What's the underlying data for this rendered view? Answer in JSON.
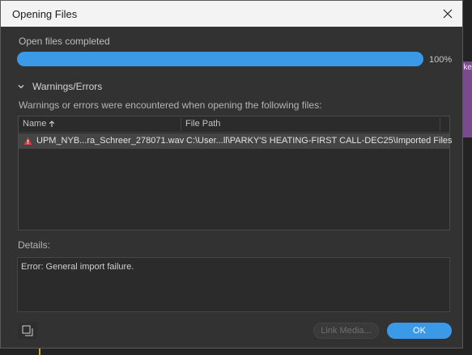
{
  "dialog": {
    "title": "Opening Files",
    "progress": {
      "label": "Open files completed",
      "percent_text": "100%",
      "value_fraction": 1.0
    },
    "warnings": {
      "section_title": "Warnings/Errors",
      "description": "Warnings or errors were encountered when opening the following files:",
      "columns": {
        "name": "Name",
        "path": "File Path"
      },
      "rows": [
        {
          "name": "UPM_NYB...ra_Schreer_278071.wav",
          "path": "C:\\User...ll\\PARKY'S HEATING-FIRST CALL-DEC25\\Imported Files",
          "status_icon": "error-icon"
        }
      ]
    },
    "details": {
      "label": "Details:",
      "text": "Error: General import failure."
    },
    "buttons": {
      "link_media": "Link Media...",
      "ok": "OK"
    }
  },
  "background": {
    "panel_label": "rke"
  },
  "colors": {
    "accent": "#3b9ae8",
    "dialog_bg": "#323232",
    "error_red": "#d9413a"
  }
}
